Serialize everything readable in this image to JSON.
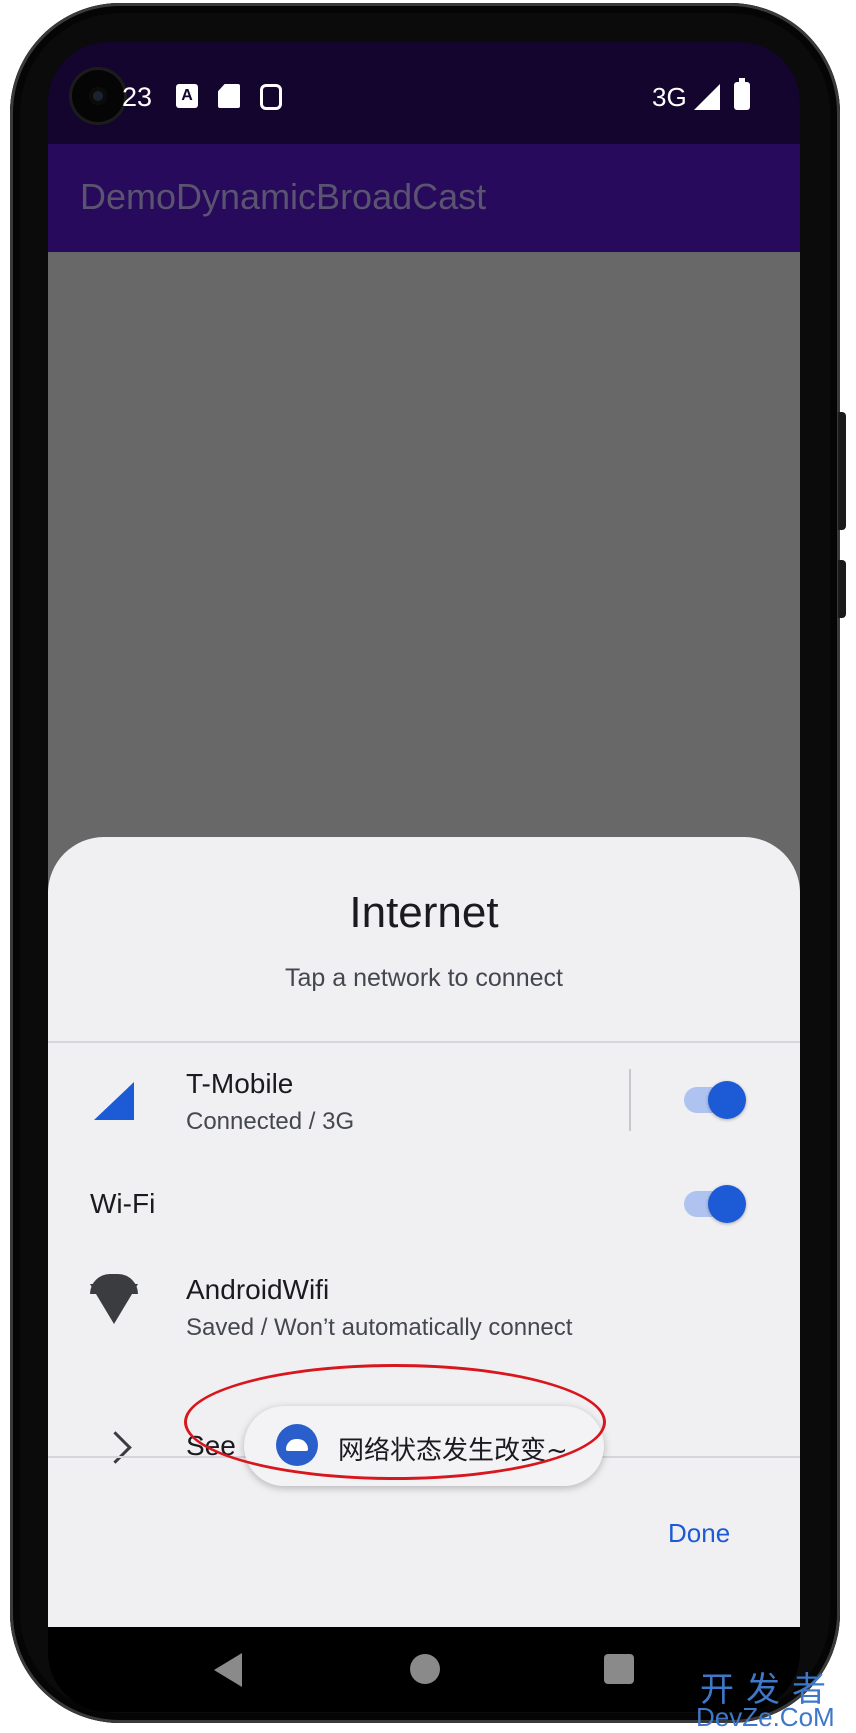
{
  "status_bar": {
    "time": "23",
    "network_type": "3G",
    "icons": [
      "camera-icon",
      "text-notification-icon",
      "sd-card-icon",
      "robot-icon",
      "signal-icon",
      "battery-icon"
    ]
  },
  "app_bar": {
    "title": "DemoDynamicBroadCast"
  },
  "internet_panel": {
    "title": "Internet",
    "subtitle": "Tap a network to connect",
    "mobile": {
      "name": "T-Mobile",
      "status": "Connected / 3G",
      "enabled": true
    },
    "wifi": {
      "label": "Wi-Fi",
      "enabled": true
    },
    "saved_network": {
      "name": "AndroidWifi",
      "status": "Saved / Won’t automatically connect"
    },
    "see_all": "See all",
    "done": "Done"
  },
  "toast": {
    "message": "网络状态发生改变~",
    "icon": "android-icon"
  },
  "nav_bar": {
    "icons": [
      "back-icon",
      "home-icon",
      "recents-icon"
    ]
  },
  "watermark": {
    "line1": "开发者",
    "line2": "DevZe.CoM"
  },
  "colors": {
    "status_bar": "#14052e",
    "app_bar": "#270a5c",
    "scrim": "#686868",
    "sheet": "#f0f0f2",
    "accent": "#1d5ad6",
    "highlight": "#d8161e",
    "watermark": "#3d78c9"
  }
}
